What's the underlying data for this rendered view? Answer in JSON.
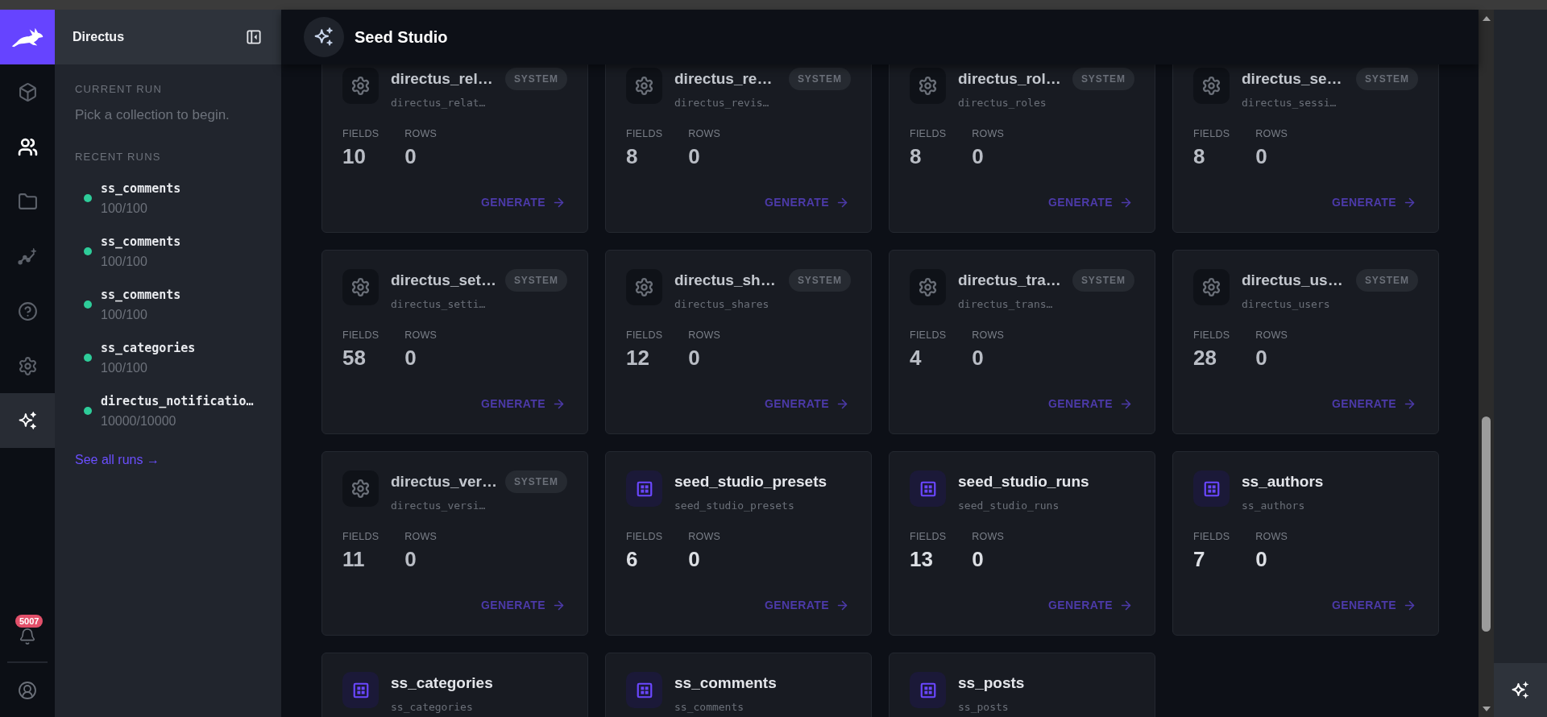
{
  "nav_rail": {
    "items": [
      {
        "kind": "content",
        "selected": false,
        "hovered": false
      },
      {
        "kind": "users",
        "selected": false,
        "hovered": true
      },
      {
        "kind": "files",
        "selected": false,
        "hovered": false
      },
      {
        "kind": "insights",
        "selected": false,
        "hovered": false
      },
      {
        "kind": "help",
        "selected": false,
        "hovered": false
      },
      {
        "kind": "settings",
        "selected": false,
        "hovered": false
      },
      {
        "kind": "seed_studio",
        "selected": true,
        "hovered": false
      }
    ],
    "notification_badge": "5007"
  },
  "sidebar": {
    "title": "Directus",
    "current_run": {
      "heading": "CURRENT RUN",
      "message": "Pick a collection to begin."
    },
    "recent_runs": {
      "heading": "RECENT RUNS",
      "items": [
        {
          "name": "ss_comments",
          "count": "100/100",
          "color": "#2ecc99"
        },
        {
          "name": "ss_comments",
          "count": "100/100",
          "color": "#2ecc99"
        },
        {
          "name": "ss_comments",
          "count": "100/100",
          "color": "#2ecc99"
        },
        {
          "name": "ss_categories",
          "count": "100/100",
          "color": "#2ecc99"
        },
        {
          "name": "directus_notificatio…",
          "count": "10000/10000",
          "color": "#2ecc99"
        }
      ]
    },
    "see_all_link": "See all runs →"
  },
  "header": {
    "title": "Seed Studio"
  },
  "collections": [
    {
      "kind": "system",
      "name": "directus_rel…",
      "table": "directus_relat…",
      "badge": "SYSTEM",
      "stats": [
        {
          "label": "FIELDS",
          "value": "10"
        },
        {
          "label": "ROWS",
          "value": "0"
        }
      ],
      "action": "GENERATE"
    },
    {
      "kind": "system",
      "name": "directus_re…",
      "table": "directus_revis…",
      "badge": "SYSTEM",
      "stats": [
        {
          "label": "FIELDS",
          "value": "8"
        },
        {
          "label": "ROWS",
          "value": "0"
        }
      ],
      "action": "GENERATE"
    },
    {
      "kind": "system",
      "name": "directus_rol…",
      "table": "directus_roles",
      "badge": "SYSTEM",
      "stats": [
        {
          "label": "FIELDS",
          "value": "8"
        },
        {
          "label": "ROWS",
          "value": "0"
        }
      ],
      "action": "GENERATE"
    },
    {
      "kind": "system",
      "name": "directus_se…",
      "table": "directus_sessi…",
      "badge": "SYSTEM",
      "stats": [
        {
          "label": "FIELDS",
          "value": "8"
        },
        {
          "label": "ROWS",
          "value": "0"
        }
      ],
      "action": "GENERATE"
    },
    {
      "kind": "system",
      "name": "directus_set…",
      "table": "directus_setti…",
      "badge": "SYSTEM",
      "stats": [
        {
          "label": "FIELDS",
          "value": "58"
        },
        {
          "label": "ROWS",
          "value": "0"
        }
      ],
      "action": "GENERATE"
    },
    {
      "kind": "system",
      "name": "directus_sh…",
      "table": "directus_shares",
      "badge": "SYSTEM",
      "stats": [
        {
          "label": "FIELDS",
          "value": "12"
        },
        {
          "label": "ROWS",
          "value": "0"
        }
      ],
      "action": "GENERATE"
    },
    {
      "kind": "system",
      "name": "directus_tra…",
      "table": "directus_trans…",
      "badge": "SYSTEM",
      "stats": [
        {
          "label": "FIELDS",
          "value": "4"
        },
        {
          "label": "ROWS",
          "value": "0"
        }
      ],
      "action": "GENERATE"
    },
    {
      "kind": "system",
      "name": "directus_us…",
      "table": "directus_users",
      "badge": "SYSTEM",
      "stats": [
        {
          "label": "FIELDS",
          "value": "28"
        },
        {
          "label": "ROWS",
          "value": "0"
        }
      ],
      "action": "GENERATE"
    },
    {
      "kind": "system",
      "name": "directus_ver…",
      "table": "directus_versi…",
      "badge": "SYSTEM",
      "stats": [
        {
          "label": "FIELDS",
          "value": "11"
        },
        {
          "label": "ROWS",
          "value": "0"
        }
      ],
      "action": "GENERATE"
    },
    {
      "kind": "collection",
      "name": "seed_studio_presets",
      "table": "seed_studio_presets",
      "stats": [
        {
          "label": "FIELDS",
          "value": "6"
        },
        {
          "label": "ROWS",
          "value": "0"
        }
      ],
      "action": "GENERATE"
    },
    {
      "kind": "collection",
      "name": "seed_studio_runs",
      "table": "seed_studio_runs",
      "stats": [
        {
          "label": "FIELDS",
          "value": "13"
        },
        {
          "label": "ROWS",
          "value": "0"
        }
      ],
      "action": "GENERATE"
    },
    {
      "kind": "collection",
      "name": "ss_authors",
      "table": "ss_authors",
      "stats": [
        {
          "label": "FIELDS",
          "value": "7"
        },
        {
          "label": "ROWS",
          "value": "0"
        }
      ],
      "action": "GENERATE"
    },
    {
      "kind": "collection",
      "name": "ss_categories",
      "table": "ss_categories"
    },
    {
      "kind": "collection",
      "name": "ss_comments",
      "table": "ss_comments"
    },
    {
      "kind": "collection",
      "name": "ss_posts",
      "table": "ss_posts"
    }
  ]
}
